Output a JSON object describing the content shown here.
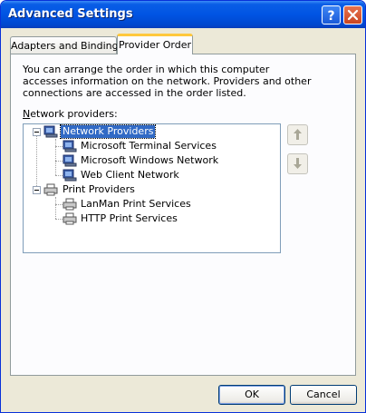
{
  "window": {
    "title": "Advanced Settings",
    "help_icon": "help-question-icon",
    "close_icon": "close-x-icon"
  },
  "tabs": [
    {
      "label": "Adapters and Bindings",
      "selected": false
    },
    {
      "label": "Provider Order",
      "selected": true
    }
  ],
  "description": "You can arrange the order in which this computer accesses information on the network.  Providers and other connections are accessed in the order listed.",
  "providers_label_prefix": "N",
  "providers_label_rest": "etwork providers:",
  "tree": {
    "groups": [
      {
        "label": "Network Providers",
        "selected": true,
        "icon": "network-provider-icon",
        "items": [
          "Microsoft Terminal Services",
          "Microsoft Windows Network",
          "Web Client Network"
        ]
      },
      {
        "label": "Print Providers",
        "selected": false,
        "icon": "printer-icon",
        "items": [
          "LanMan Print Services",
          "HTTP Print Services"
        ]
      }
    ]
  },
  "move_up_icon": "arrow-up-icon",
  "move_down_icon": "arrow-down-icon",
  "buttons": {
    "ok": "OK",
    "cancel": "Cancel"
  },
  "colors": {
    "titlebar": "#0054e3",
    "selection": "#316ac5",
    "dialog_bg": "#ece9d8"
  }
}
